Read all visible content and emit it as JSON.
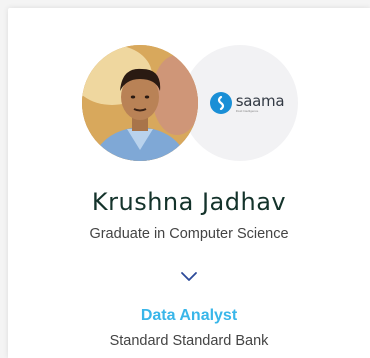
{
  "profile": {
    "name": "Krushna Jadhav",
    "degree": "Graduate in Computer Science",
    "role": "Data Analyst",
    "company": "Standard Standard Bank"
  },
  "company_logo": {
    "text": "saama",
    "tagline": "Fluid Intelligence",
    "color": "#1a8fd6"
  },
  "colors": {
    "name": "#14332b",
    "role": "#39b6e9",
    "chevron": "#2c4a9a"
  },
  "icons": {
    "photo": "person-avatar",
    "chevron": "chevron-down-icon"
  }
}
